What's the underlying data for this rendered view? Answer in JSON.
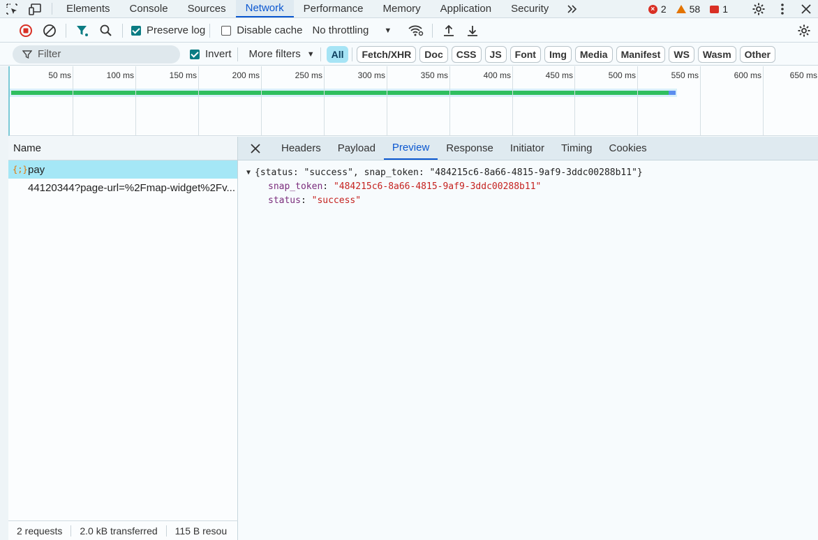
{
  "tabs": [
    "Elements",
    "Console",
    "Sources",
    "Network",
    "Performance",
    "Memory",
    "Application",
    "Security"
  ],
  "active_tab": "Network",
  "status": {
    "errors": "2",
    "warnings": "58",
    "issues": "1"
  },
  "toolbar": {
    "preserve_log": "Preserve log",
    "disable_cache": "Disable cache",
    "throttling": "No throttling"
  },
  "filterbar": {
    "filter_placeholder": "Filter",
    "invert": "Invert",
    "more_filters": "More filters",
    "chips": [
      "All",
      "Fetch/XHR",
      "Doc",
      "CSS",
      "JS",
      "Font",
      "Img",
      "Media",
      "Manifest",
      "WS",
      "Wasm",
      "Other"
    ],
    "active_chip": "All"
  },
  "timeline": {
    "ticks": [
      "50 ms",
      "100 ms",
      "150 ms",
      "200 ms",
      "250 ms",
      "300 ms",
      "350 ms",
      "400 ms",
      "450 ms",
      "500 ms",
      "550 ms",
      "600 ms",
      "650 ms"
    ]
  },
  "requests": {
    "header": "Name",
    "items": [
      {
        "icon": "{;}",
        "name": "pay",
        "selected": true
      },
      {
        "icon": "",
        "name": "44120344?page-url=%2Fmap-widget%2Fv...",
        "selected": false
      }
    ],
    "footer": {
      "count": "2 requests",
      "transferred": "2.0 kB transferred",
      "resources": "115 B resou"
    }
  },
  "detail": {
    "tabs": [
      "Headers",
      "Payload",
      "Preview",
      "Response",
      "Initiator",
      "Timing",
      "Cookies"
    ],
    "active_tab": "Preview",
    "preview": {
      "summary": "{status: \"success\", snap_token: \"484215c6-8a66-4815-9af9-3ddc00288b11\"}",
      "fields": [
        {
          "key": "snap_token",
          "value": "\"484215c6-8a66-4815-9af9-3ddc00288b11\""
        },
        {
          "key": "status",
          "value": "\"success\""
        }
      ]
    }
  }
}
